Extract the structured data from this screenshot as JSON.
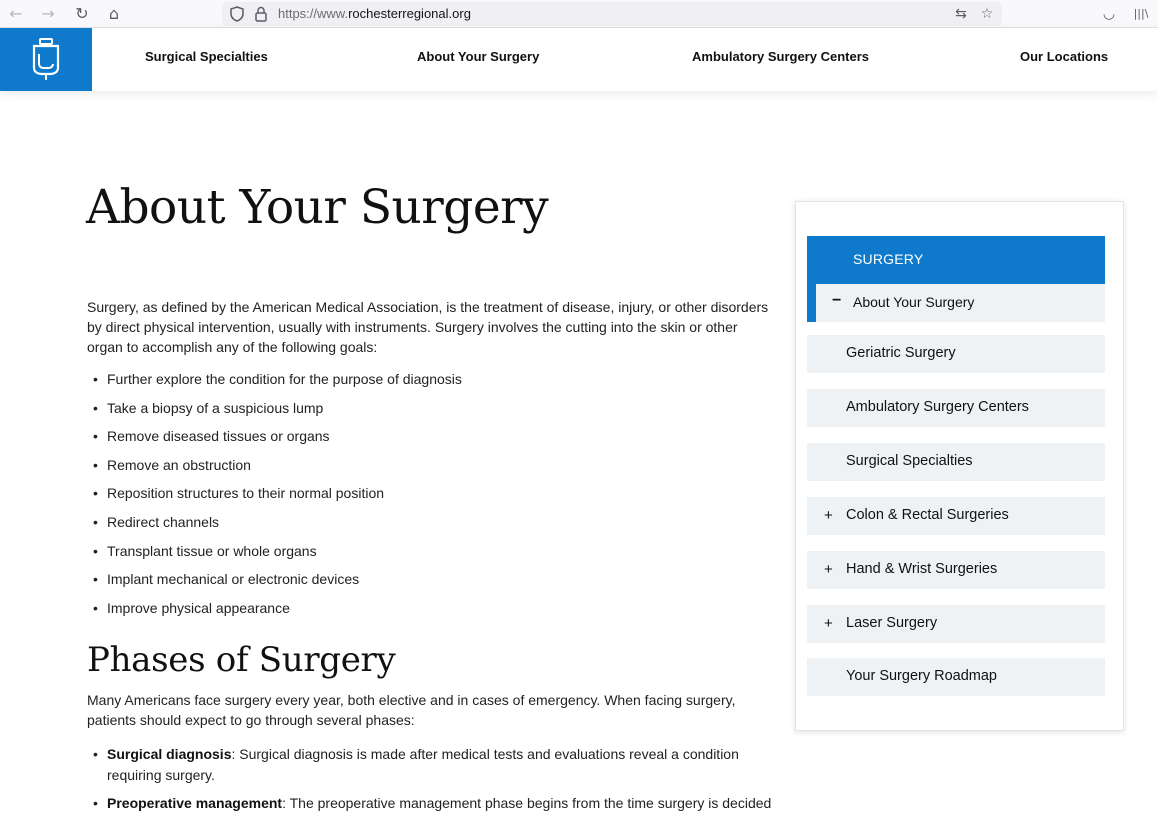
{
  "browser": {
    "back_icon": "←",
    "forward_icon": "→",
    "reload_icon": "↻",
    "home_icon": "⌂",
    "url_scheme": "https://www.",
    "url_host": "rochesterregional.org",
    "translate_icon": "⇆",
    "star_icon": "☆",
    "pocket_icon": "◡",
    "library_icon": "|||\\"
  },
  "header": {
    "nav": [
      {
        "label": "Surgical Specialties"
      },
      {
        "label": "About Your Surgery"
      },
      {
        "label": "Ambulatory Surgery Centers"
      },
      {
        "label": "Our Locations"
      }
    ],
    "brand_color": "#0f7acc"
  },
  "main": {
    "title": "About Your Surgery",
    "intro": "Surgery, as defined by the American Medical Association, is the treatment of disease, injury, or other disorders by direct physical intervention, usually with instruments. Surgery involves the cutting into the skin or other organ to accomplish any of the following goals:",
    "goals": [
      "Further explore the condition for the purpose of diagnosis",
      "Take a biopsy of a suspicious lump",
      "Remove diseased tissues or organs",
      "Remove an obstruction",
      "Reposition structures to their normal position",
      "Redirect channels",
      "Transplant tissue or whole organs",
      "Implant mechanical or electronic devices",
      "Improve physical appearance"
    ],
    "phases_title": "Phases of Surgery",
    "phases_intro": "Many Americans face surgery every year, both elective and in cases of emergency. When facing surgery, patients should expect to go through several phases:",
    "phases": [
      {
        "term": "Surgical diagnosis",
        "text": ": Surgical diagnosis is made after medical tests and evaluations reveal a condition requiring surgery."
      },
      {
        "term": "Preoperative management",
        "text": ": The preoperative management phase begins from the time surgery is decided to"
      }
    ]
  },
  "sidebar": {
    "heading": "SURGERY",
    "active": {
      "sign": "−",
      "label": "About Your Surgery"
    },
    "items": [
      {
        "sign": "",
        "label": "Geriatric Surgery"
      },
      {
        "sign": "",
        "label": "Ambulatory Surgery Centers"
      },
      {
        "sign": "",
        "label": "Surgical Specialties"
      },
      {
        "sign": "+",
        "label": "Colon & Rectal Surgeries"
      },
      {
        "sign": "+",
        "label": "Hand & Wrist Surgeries"
      },
      {
        "sign": "+",
        "label": "Laser Surgery"
      },
      {
        "sign": "",
        "label": "Your Surgery Roadmap"
      }
    ]
  }
}
